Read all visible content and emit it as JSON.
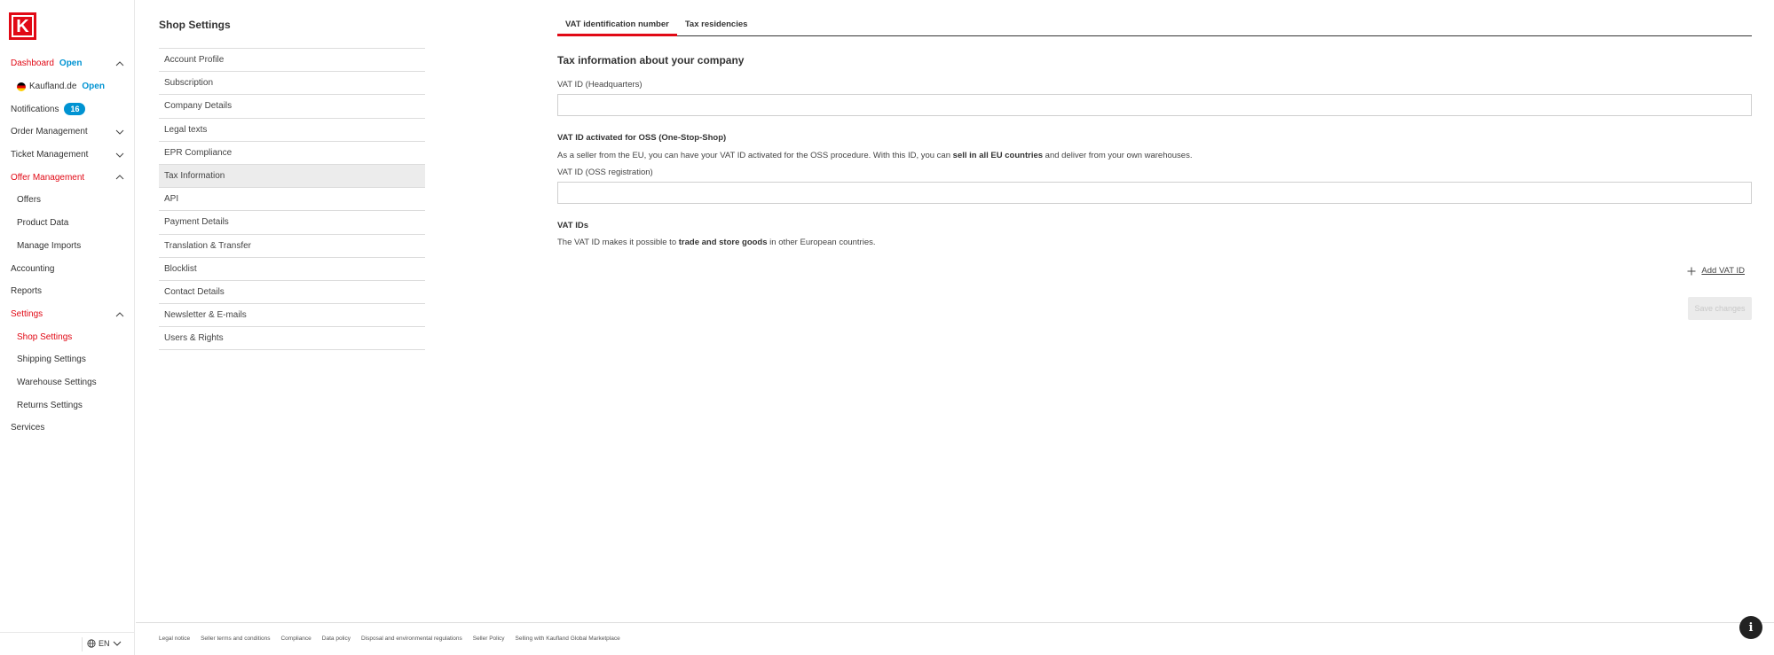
{
  "brand": {
    "logo_letter": "K",
    "accent_color": "#e10915",
    "info_color": "#0093d2"
  },
  "sidebar": {
    "items": [
      {
        "label": "Dashboard",
        "tag": "Open",
        "chevron": "up",
        "active": true
      },
      {
        "label": "Kaufland.de",
        "tag": "Open",
        "flag": "de",
        "sub": true
      },
      {
        "label": "Notifications",
        "badge": "16"
      },
      {
        "label": "Order Management",
        "chevron": "down"
      },
      {
        "label": "Ticket Management",
        "chevron": "down"
      },
      {
        "label": "Offer Management",
        "chevron": "up",
        "active": true
      },
      {
        "label": "Offers",
        "sub": true
      },
      {
        "label": "Product Data",
        "sub": true
      },
      {
        "label": "Manage Imports",
        "sub": true
      },
      {
        "label": "Accounting"
      },
      {
        "label": "Reports"
      },
      {
        "label": "Settings",
        "chevron": "up",
        "active": true
      },
      {
        "label": "Shop Settings",
        "sub": true,
        "active": true
      },
      {
        "label": "Shipping Settings",
        "sub": true
      },
      {
        "label": "Warehouse Settings",
        "sub": true
      },
      {
        "label": "Returns Settings",
        "sub": true
      },
      {
        "label": "Services"
      }
    ],
    "language": "EN"
  },
  "settings": {
    "title": "Shop Settings",
    "items": [
      "Account Profile",
      "Subscription",
      "Company Details",
      "Legal texts",
      "EPR Compliance",
      "Tax Information",
      "API",
      "Payment Details",
      "Translation & Transfer",
      "Blocklist",
      "Contact Details",
      "Newsletter & E-mails",
      "Users & Rights"
    ],
    "selected_index": 5
  },
  "main": {
    "tabs": [
      {
        "label": "VAT identification number",
        "active": true
      },
      {
        "label": "Tax residencies",
        "active": false
      }
    ],
    "heading": "Tax information about your company",
    "vat_hq_label": "VAT ID (Headquarters)",
    "vat_hq_value": "",
    "oss_title": "VAT ID activated for OSS (One-Stop-Shop)",
    "oss_text_1": "As a seller from the EU, you can have your VAT ID activated for the OSS procedure. With this ID, you can ",
    "oss_text_bold": "sell in all EU countries",
    "oss_text_2": " and deliver from your own warehouses.",
    "vat_oss_label": "VAT ID (OSS registration)",
    "vat_oss_value": "",
    "vat_ids_title": "VAT IDs",
    "vat_ids_text_1": "The VAT ID makes it possible to ",
    "vat_ids_text_bold": "trade and store goods",
    "vat_ids_text_2": " in other European countries.",
    "add_vat_label": "Add VAT ID",
    "save_label": "Save changes"
  },
  "footer": {
    "links": [
      "Legal notice",
      "Seller terms and conditions",
      "Compliance",
      "Data policy",
      "Disposal and environmental regulations",
      "Seller Policy",
      "Selling with Kaufland Global Marketplace"
    ],
    "info_label": "i"
  }
}
